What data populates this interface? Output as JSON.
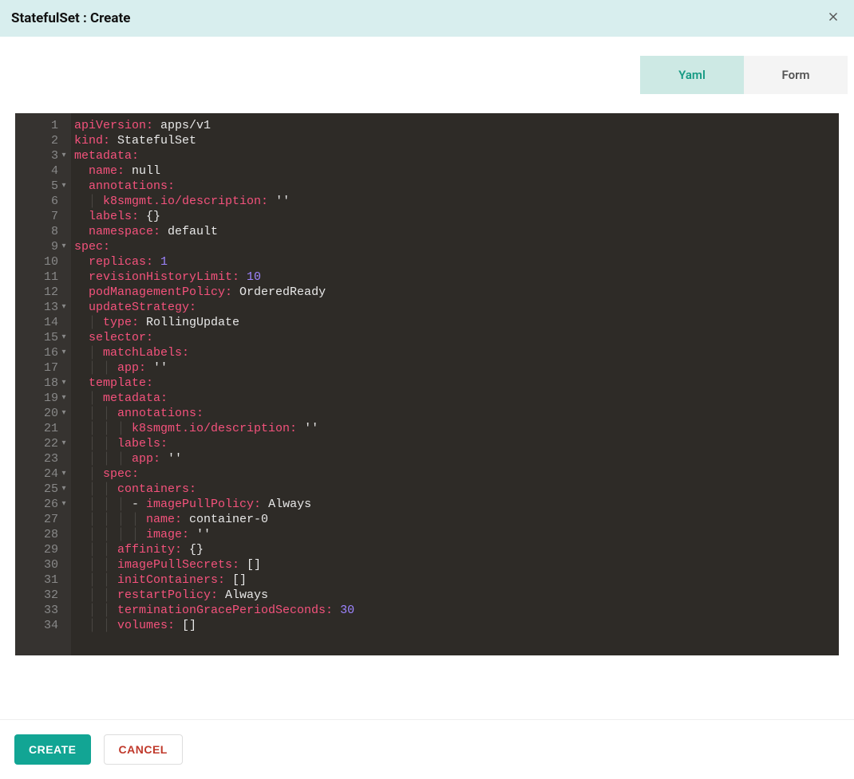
{
  "header": {
    "title": "StatefulSet : Create"
  },
  "tabs": {
    "yaml": "Yaml",
    "form": "Form",
    "active": "yaml"
  },
  "editor": {
    "lines": [
      {
        "n": 1,
        "fold": "",
        "segs": [
          [
            "k",
            "apiVersion:"
          ],
          [
            "v",
            " apps/v1"
          ]
        ]
      },
      {
        "n": 2,
        "fold": "",
        "segs": [
          [
            "k",
            "kind:"
          ],
          [
            "v",
            " StatefulSet"
          ]
        ]
      },
      {
        "n": 3,
        "fold": "▾",
        "segs": [
          [
            "k",
            "metadata:"
          ]
        ]
      },
      {
        "n": 4,
        "fold": "",
        "segs": [
          [
            "guide",
            "  "
          ],
          [
            "k",
            "name:"
          ],
          [
            "v",
            " null"
          ]
        ]
      },
      {
        "n": 5,
        "fold": "▾",
        "segs": [
          [
            "guide",
            "  "
          ],
          [
            "k",
            "annotations:"
          ]
        ]
      },
      {
        "n": 6,
        "fold": "",
        "segs": [
          [
            "guide",
            "  | "
          ],
          [
            "k",
            "k8smgmt.io/description:"
          ],
          [
            "s",
            " ''"
          ]
        ]
      },
      {
        "n": 7,
        "fold": "",
        "segs": [
          [
            "guide",
            "  "
          ],
          [
            "k",
            "labels:"
          ],
          [
            "v",
            " {}"
          ]
        ]
      },
      {
        "n": 8,
        "fold": "",
        "segs": [
          [
            "guide",
            "  "
          ],
          [
            "k",
            "namespace:"
          ],
          [
            "v",
            " default"
          ]
        ]
      },
      {
        "n": 9,
        "fold": "▾",
        "segs": [
          [
            "k",
            "spec:"
          ]
        ]
      },
      {
        "n": 10,
        "fold": "",
        "segs": [
          [
            "guide",
            "  "
          ],
          [
            "k",
            "replicas:"
          ],
          [
            "n",
            " 1"
          ]
        ]
      },
      {
        "n": 11,
        "fold": "",
        "segs": [
          [
            "guide",
            "  "
          ],
          [
            "k",
            "revisionHistoryLimit:"
          ],
          [
            "n",
            " 10"
          ]
        ]
      },
      {
        "n": 12,
        "fold": "",
        "segs": [
          [
            "guide",
            "  "
          ],
          [
            "k",
            "podManagementPolicy:"
          ],
          [
            "v",
            " OrderedReady"
          ]
        ]
      },
      {
        "n": 13,
        "fold": "▾",
        "segs": [
          [
            "guide",
            "  "
          ],
          [
            "k",
            "updateStrategy:"
          ]
        ]
      },
      {
        "n": 14,
        "fold": "",
        "segs": [
          [
            "guide",
            "  | "
          ],
          [
            "k",
            "type:"
          ],
          [
            "v",
            " RollingUpdate"
          ]
        ]
      },
      {
        "n": 15,
        "fold": "▾",
        "segs": [
          [
            "guide",
            "  "
          ],
          [
            "k",
            "selector:"
          ]
        ]
      },
      {
        "n": 16,
        "fold": "▾",
        "segs": [
          [
            "guide",
            "  | "
          ],
          [
            "k",
            "matchLabels:"
          ]
        ]
      },
      {
        "n": 17,
        "fold": "",
        "segs": [
          [
            "guide",
            "  | | "
          ],
          [
            "k",
            "app:"
          ],
          [
            "s",
            " ''"
          ]
        ]
      },
      {
        "n": 18,
        "fold": "▾",
        "segs": [
          [
            "guide",
            "  "
          ],
          [
            "k",
            "template:"
          ]
        ]
      },
      {
        "n": 19,
        "fold": "▾",
        "segs": [
          [
            "guide",
            "  | "
          ],
          [
            "k",
            "metadata:"
          ]
        ]
      },
      {
        "n": 20,
        "fold": "▾",
        "segs": [
          [
            "guide",
            "  | | "
          ],
          [
            "k",
            "annotations:"
          ]
        ]
      },
      {
        "n": 21,
        "fold": "",
        "segs": [
          [
            "guide",
            "  | | | "
          ],
          [
            "k",
            "k8smgmt.io/description:"
          ],
          [
            "s",
            " ''"
          ]
        ]
      },
      {
        "n": 22,
        "fold": "▾",
        "segs": [
          [
            "guide",
            "  | | "
          ],
          [
            "k",
            "labels:"
          ]
        ]
      },
      {
        "n": 23,
        "fold": "",
        "segs": [
          [
            "guide",
            "  | | | "
          ],
          [
            "k",
            "app:"
          ],
          [
            "s",
            " ''"
          ]
        ]
      },
      {
        "n": 24,
        "fold": "▾",
        "segs": [
          [
            "guide",
            "  | "
          ],
          [
            "k",
            "spec:"
          ]
        ]
      },
      {
        "n": 25,
        "fold": "▾",
        "segs": [
          [
            "guide",
            "  | | "
          ],
          [
            "k",
            "containers:"
          ]
        ]
      },
      {
        "n": 26,
        "fold": "▾",
        "segs": [
          [
            "guide",
            "  | | | "
          ],
          [
            "dash",
            "- "
          ],
          [
            "k",
            "imagePullPolicy:"
          ],
          [
            "v",
            " Always"
          ]
        ]
      },
      {
        "n": 27,
        "fold": "",
        "segs": [
          [
            "guide",
            "  | | | | "
          ],
          [
            "k",
            "name:"
          ],
          [
            "v",
            " container-0"
          ]
        ]
      },
      {
        "n": 28,
        "fold": "",
        "segs": [
          [
            "guide",
            "  | | | | "
          ],
          [
            "k",
            "image:"
          ],
          [
            "s",
            " ''"
          ]
        ]
      },
      {
        "n": 29,
        "fold": "",
        "segs": [
          [
            "guide",
            "  | | "
          ],
          [
            "k",
            "affinity:"
          ],
          [
            "v",
            " {}"
          ]
        ]
      },
      {
        "n": 30,
        "fold": "",
        "segs": [
          [
            "guide",
            "  | | "
          ],
          [
            "k",
            "imagePullSecrets:"
          ],
          [
            "v",
            " []"
          ]
        ]
      },
      {
        "n": 31,
        "fold": "",
        "segs": [
          [
            "guide",
            "  | | "
          ],
          [
            "k",
            "initContainers:"
          ],
          [
            "v",
            " []"
          ]
        ]
      },
      {
        "n": 32,
        "fold": "",
        "segs": [
          [
            "guide",
            "  | | "
          ],
          [
            "k",
            "restartPolicy:"
          ],
          [
            "v",
            " Always"
          ]
        ]
      },
      {
        "n": 33,
        "fold": "",
        "segs": [
          [
            "guide",
            "  | | "
          ],
          [
            "k",
            "terminationGracePeriodSeconds:"
          ],
          [
            "n",
            " 30"
          ]
        ]
      },
      {
        "n": 34,
        "fold": "",
        "segs": [
          [
            "guide",
            "  | | "
          ],
          [
            "k",
            "volumes:"
          ],
          [
            "v",
            " []"
          ]
        ]
      }
    ]
  },
  "footer": {
    "create": "CREATE",
    "cancel": "CANCEL"
  }
}
